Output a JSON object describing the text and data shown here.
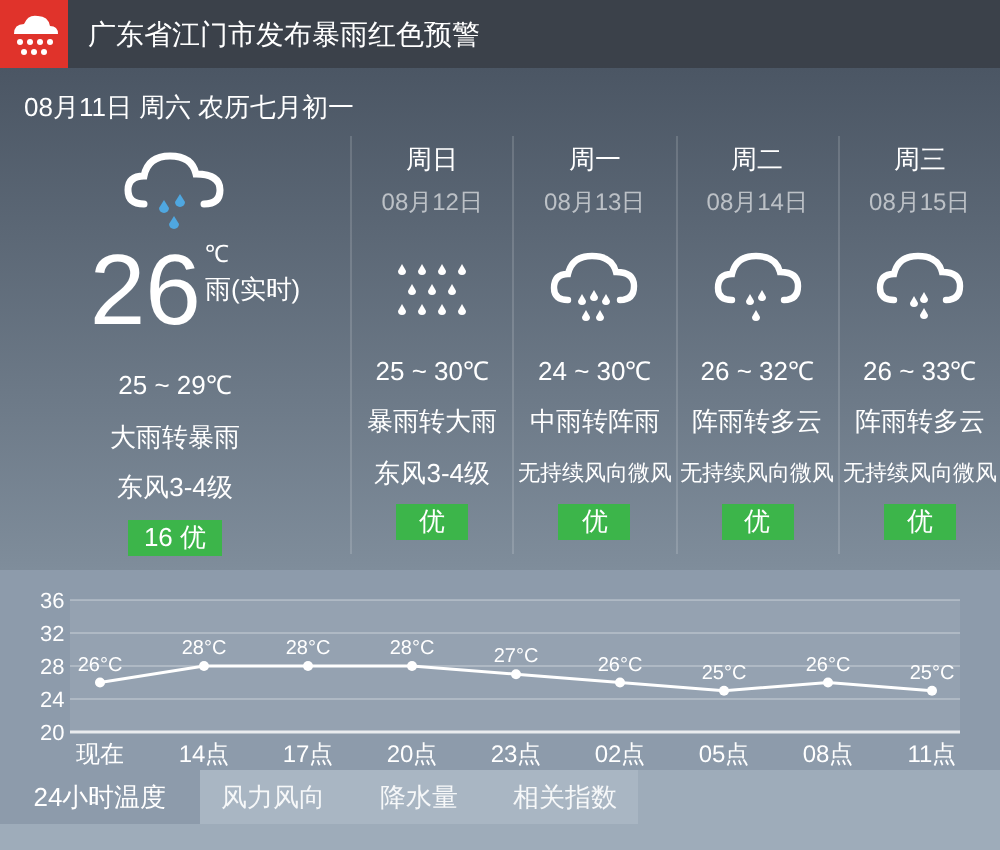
{
  "alert": {
    "title": "广东省江门市发布暴雨红色预警"
  },
  "today": {
    "date": "08月11日 周六 农历七月初一",
    "temp": "26",
    "unit": "℃",
    "condition": "雨(实时)",
    "range": "25 ~ 29℃",
    "weather": "大雨转暴雨",
    "wind": "东风3-4级",
    "aqi": "16 优"
  },
  "forecast": [
    {
      "day": "周日",
      "date": "08月12日",
      "kind": "storm",
      "range": "25 ~ 30℃",
      "weather": "暴雨转大雨",
      "wind": "东风3-4级",
      "aqi": "优"
    },
    {
      "day": "周一",
      "date": "08月13日",
      "kind": "moderate",
      "range": "24 ~ 30℃",
      "weather": "中雨转阵雨",
      "wind": "无持续风向微风",
      "aqi": "优"
    },
    {
      "day": "周二",
      "date": "08月14日",
      "kind": "shower",
      "range": "26 ~ 32℃",
      "weather": "阵雨转多云",
      "wind": "无持续风向微风",
      "aqi": "优"
    },
    {
      "day": "周三",
      "date": "08月15日",
      "kind": "light",
      "range": "26 ~ 33℃",
      "weather": "阵雨转多云",
      "wind": "无持续风向微风",
      "aqi": "优"
    }
  ],
  "hourly": {
    "chart_data": {
      "type": "line",
      "categories": [
        "现在",
        "14点",
        "17点",
        "20点",
        "23点",
        "02点",
        "05点",
        "08点",
        "11点"
      ],
      "series": [
        {
          "color": "#ffffff",
          "marker": true,
          "values": [
            26,
            28,
            28,
            28,
            27,
            26,
            25,
            26,
            25
          ]
        }
      ],
      "ylim": [
        20,
        36
      ],
      "yticks": [
        20,
        24,
        28,
        32,
        36
      ],
      "grid": true,
      "value_labels": [
        "26°C",
        "28°C",
        "28°C",
        "28°C",
        "27°C",
        "26°C",
        "25°C",
        "26°C",
        "25°C"
      ]
    }
  },
  "tabs": [
    {
      "label": "24小时温度",
      "selected": true
    },
    {
      "label": "风力风向",
      "selected": false
    },
    {
      "label": "降水量",
      "selected": false
    },
    {
      "label": "相关指数",
      "selected": false
    }
  ]
}
